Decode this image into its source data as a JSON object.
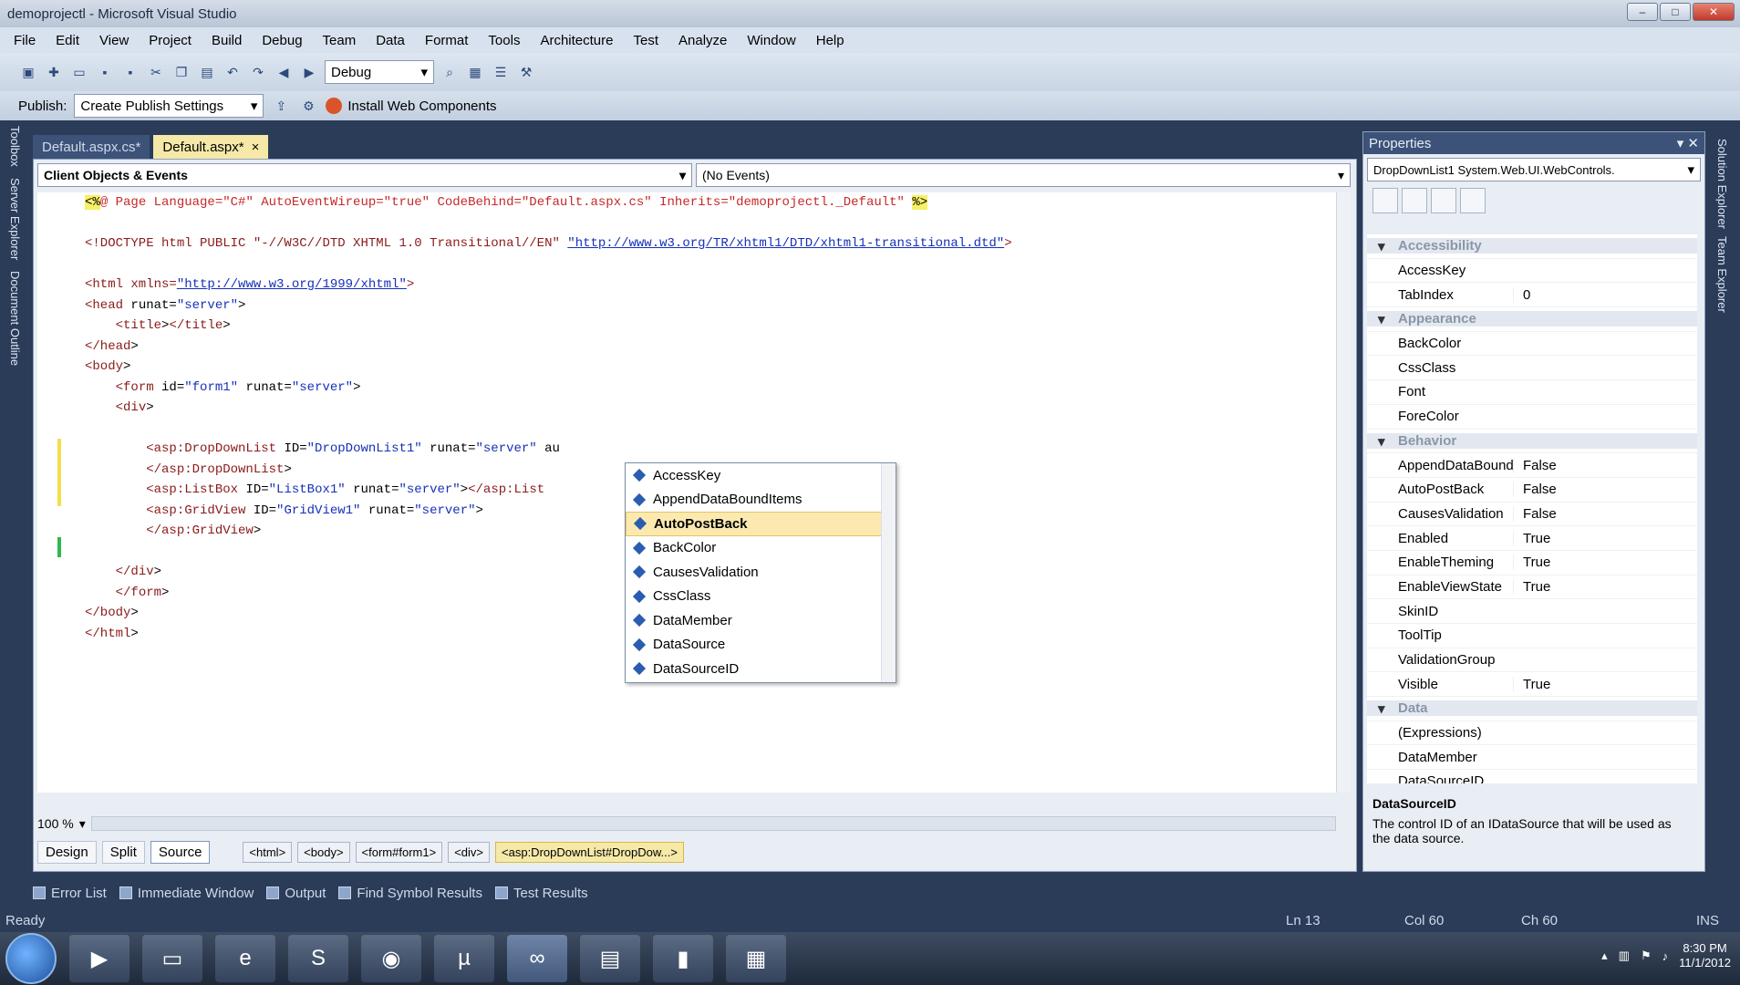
{
  "window": {
    "title": "demoprojectl - Microsoft Visual Studio"
  },
  "menu": [
    "File",
    "Edit",
    "View",
    "Project",
    "Build",
    "Debug",
    "Team",
    "Data",
    "Format",
    "Tools",
    "Architecture",
    "Test",
    "Analyze",
    "Window",
    "Help"
  ],
  "toolbar": {
    "config": "Debug",
    "publish_label": "Publish:",
    "publish_value": "Create Publish Settings",
    "install_web": "Install Web Components"
  },
  "left_tabs": [
    "Toolbox",
    "Server Explorer",
    "Document Outline"
  ],
  "right_tabs": [
    "Solution Explorer",
    "Team Explorer"
  ],
  "doc_tabs": [
    {
      "label": "Default.aspx.cs*"
    },
    {
      "label": "Default.aspx*",
      "close": "×"
    }
  ],
  "editor": {
    "object_select": "Client Objects & Events",
    "event_select": "(No Events)",
    "lines": [
      {
        "type": "dir",
        "text": "<%@ Page Language=\"C#\" AutoEventWireup=\"true\" CodeBehind=\"Default.aspx.cs\" Inherits=\"demoprojectl._Default\" %>"
      },
      {
        "type": "blank",
        "text": ""
      },
      {
        "type": "doctype",
        "text": "<!DOCTYPE html PUBLIC \"-//W3C//DTD XHTML 1.0 Transitional//EN\" ",
        "link": "\"http://www.w3.org/TR/xhtml1/DTD/xhtml1-transitional.dtd\"",
        "tail": ">"
      },
      {
        "type": "blank",
        "text": ""
      },
      {
        "type": "html",
        "text": "<html xmlns=",
        "link": "\"http://www.w3.org/1999/xhtml\"",
        "tail": ">"
      },
      {
        "type": "tag",
        "text": "<head runat=\"server\">"
      },
      {
        "type": "tag",
        "text": "    <title></title>"
      },
      {
        "type": "tag",
        "text": "</head>"
      },
      {
        "type": "tag",
        "text": "<body>"
      },
      {
        "type": "tag",
        "text": "    <form id=\"form1\" runat=\"server\">"
      },
      {
        "type": "tag",
        "text": "    <div>"
      },
      {
        "type": "blank",
        "text": ""
      },
      {
        "type": "tag",
        "text": "        <asp:DropDownList ID=\"DropDownList1\" runat=\"server\" au"
      },
      {
        "type": "tag",
        "text": "        </asp:DropDownList>"
      },
      {
        "type": "tag",
        "text": "        <asp:ListBox ID=\"ListBox1\" runat=\"server\"></asp:List"
      },
      {
        "type": "tag",
        "text": "        <asp:GridView ID=\"GridView1\" runat=\"server\">"
      },
      {
        "type": "tag",
        "text": "        </asp:GridView>"
      },
      {
        "type": "blank",
        "text": ""
      },
      {
        "type": "tag",
        "text": "    </div>"
      },
      {
        "type": "tag",
        "text": "    </form>"
      },
      {
        "type": "tag",
        "text": "</body>"
      },
      {
        "type": "tag",
        "text": "</html>"
      }
    ],
    "intellisense": [
      "AccessKey",
      "AppendDataBoundItems",
      "AutoPostBack",
      "BackColor",
      "CausesValidation",
      "CssClass",
      "DataMember",
      "DataSource",
      "DataSourceID"
    ],
    "intellisense_selected": 2,
    "zoom": "100 %",
    "views": [
      "Design",
      "Split",
      "Source"
    ],
    "breadcrumbs": [
      "<html>",
      "<body>",
      "<form#form1>",
      "<div>",
      "<asp:DropDownList#DropDow...>"
    ]
  },
  "properties": {
    "title": "Properties",
    "object": "DropDownList1  System.Web.UI.WebControls.",
    "rows": [
      {
        "cat": "Accessibility"
      },
      {
        "name": "AccessKey",
        "value": ""
      },
      {
        "name": "TabIndex",
        "value": "0"
      },
      {
        "cat": "Appearance"
      },
      {
        "name": "BackColor",
        "value": ""
      },
      {
        "name": "CssClass",
        "value": ""
      },
      {
        "name": "Font",
        "value": ""
      },
      {
        "name": "ForeColor",
        "value": ""
      },
      {
        "cat": "Behavior"
      },
      {
        "name": "AppendDataBound",
        "value": "False"
      },
      {
        "name": "AutoPostBack",
        "value": "False"
      },
      {
        "name": "CausesValidation",
        "value": "False"
      },
      {
        "name": "Enabled",
        "value": "True"
      },
      {
        "name": "EnableTheming",
        "value": "True"
      },
      {
        "name": "EnableViewState",
        "value": "True"
      },
      {
        "name": "SkinID",
        "value": ""
      },
      {
        "name": "ToolTip",
        "value": ""
      },
      {
        "name": "ValidationGroup",
        "value": ""
      },
      {
        "name": "Visible",
        "value": "True"
      },
      {
        "cat": "Data"
      },
      {
        "name": "(Expressions)",
        "value": ""
      },
      {
        "name": "DataMember",
        "value": ""
      },
      {
        "name": "DataSourceID",
        "value": ""
      }
    ],
    "desc_title": "DataSourceID",
    "desc_text": "The control ID of an IDataSource that will be used as the data source."
  },
  "bottom_tabs": [
    "Error List",
    "Immediate Window",
    "Output",
    "Find Symbol Results",
    "Test Results"
  ],
  "status": {
    "left": "Ready",
    "ln": "Ln 13",
    "col": "Col 60",
    "ch": "Ch 60",
    "mode": "INS"
  },
  "tray": {
    "time": "8:30 PM",
    "date": "11/1/2012"
  }
}
